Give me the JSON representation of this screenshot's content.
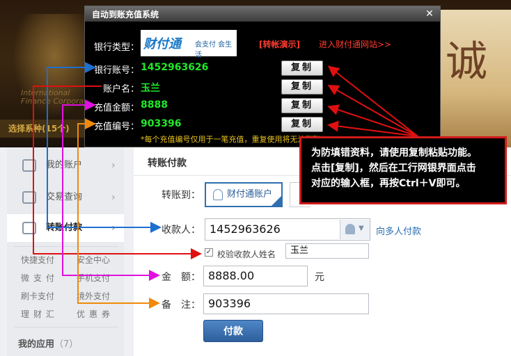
{
  "background": {
    "intl_text_1": "International",
    "intl_text_2": "Finance Corporation",
    "choose_text": "选择系种(15个)",
    "banner_char": "诚"
  },
  "popup": {
    "title": "自动到账充值系统",
    "close_glyph": "✕",
    "bank_type_label": "银行类型：",
    "bank_logo_text": "财付通",
    "bank_logo_slogan": "会支付 会生活",
    "demo_link": "[转帐演示]",
    "portal_link": "进入财付通网站>>",
    "rows": [
      {
        "label": "银行账号：",
        "value": "1452963626",
        "button": "复制"
      },
      {
        "label": "账户名：",
        "value": "玉兰",
        "button": "复制"
      },
      {
        "label": "充值金额：",
        "value": "8888",
        "button": "复制"
      },
      {
        "label": "充值编号：",
        "value": "903396",
        "button": "复制"
      }
    ],
    "note": "*每个充值编号仅用于一笔充值，重复使用将无法到账！"
  },
  "tooltip": {
    "lines": [
      "为防填错资料，请使用复制粘贴功能。",
      "点击[复制]，然后在工行网银界面点击",
      "对应的输入框，再按Ctrl＋V即可。"
    ]
  },
  "leftnav": {
    "items": [
      {
        "label": "我的账户",
        "chevron": "›"
      },
      {
        "label": "交易查询",
        "chevron": "›"
      },
      {
        "label": "转账付款",
        "chevron": "›"
      }
    ],
    "sub_links": [
      "快捷支付",
      "安全中心",
      "微支付",
      "手机支付",
      "刷卡支付",
      "境外支付",
      "理财汇",
      "优惠券"
    ],
    "apps_title": "我的应用",
    "apps_count": "（7）"
  },
  "form": {
    "title": "转账付款",
    "transfer_to_label": "转账到：",
    "account_option": "财付通账户",
    "payee_label": "收款人：",
    "payee_value": "1452963626",
    "multi_payee_link": "向多人付款",
    "verify_label": "校验收款人姓名",
    "verify_checked": "✓",
    "verify_name": "玉兰",
    "amount_label": "金　额：",
    "amount_value": "8888.00",
    "amount_unit": "元",
    "remark_label": "备　注：",
    "remark_value": "903396",
    "pay_button": "付款"
  },
  "colors": {
    "green_value": "#21e829",
    "arrow_blue": "#1e6fd0",
    "arrow_red": "#e01010",
    "arrow_magenta": "#e010e0",
    "arrow_orange": "#f08a0a"
  }
}
